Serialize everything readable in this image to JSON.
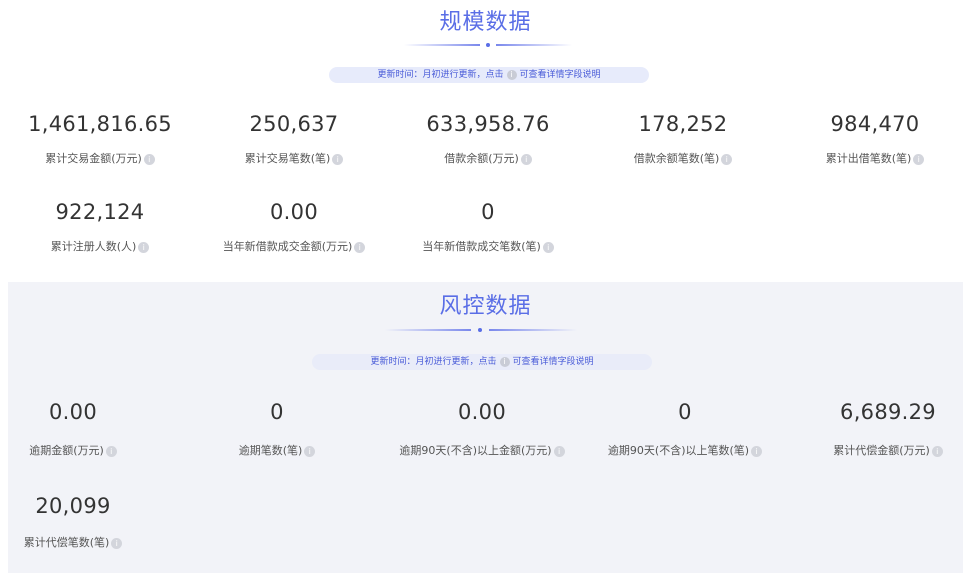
{
  "scale_section": {
    "title": "规模数据",
    "notice_prefix": "更新时间：月初进行更新，点击",
    "notice_suffix": "可查看详情字段说明",
    "metrics": [
      {
        "value": "1,461,816.65",
        "label": "累计交易金额(万元)"
      },
      {
        "value": "250,637",
        "label": "累计交易笔数(笔)"
      },
      {
        "value": "633,958.76",
        "label": "借款余额(万元)"
      },
      {
        "value": "178,252",
        "label": "借款余额笔数(笔)"
      },
      {
        "value": "984,470",
        "label": "累计出借笔数(笔)"
      },
      {
        "value": "922,124",
        "label": "累计注册人数(人)"
      },
      {
        "value": "0.00",
        "label": "当年新借款成交金额(万元)"
      },
      {
        "value": "0",
        "label": "当年新借款成交笔数(笔)"
      }
    ]
  },
  "risk_section": {
    "title": "风控数据",
    "notice_prefix": "更新时间：月初进行更新，点击",
    "notice_suffix": "可查看详情字段说明",
    "metrics": [
      {
        "value": "0.00",
        "label": "逾期金额(万元)"
      },
      {
        "value": "0",
        "label": "逾期笔数(笔)"
      },
      {
        "value": "0.00",
        "label": "逾期90天(不含)以上金额(万元)"
      },
      {
        "value": "0",
        "label": "逾期90天(不含)以上笔数(笔)"
      },
      {
        "value": "6,689.29",
        "label": "累计代偿金额(万元)"
      },
      {
        "value": "20,099",
        "label": "累计代偿笔数(笔)"
      }
    ]
  },
  "info_icon_glyph": "i",
  "colors": {
    "accent": "#5a6ee6",
    "notice_bg": "#e7ebfb",
    "risk_bg": "#f2f3f8"
  }
}
